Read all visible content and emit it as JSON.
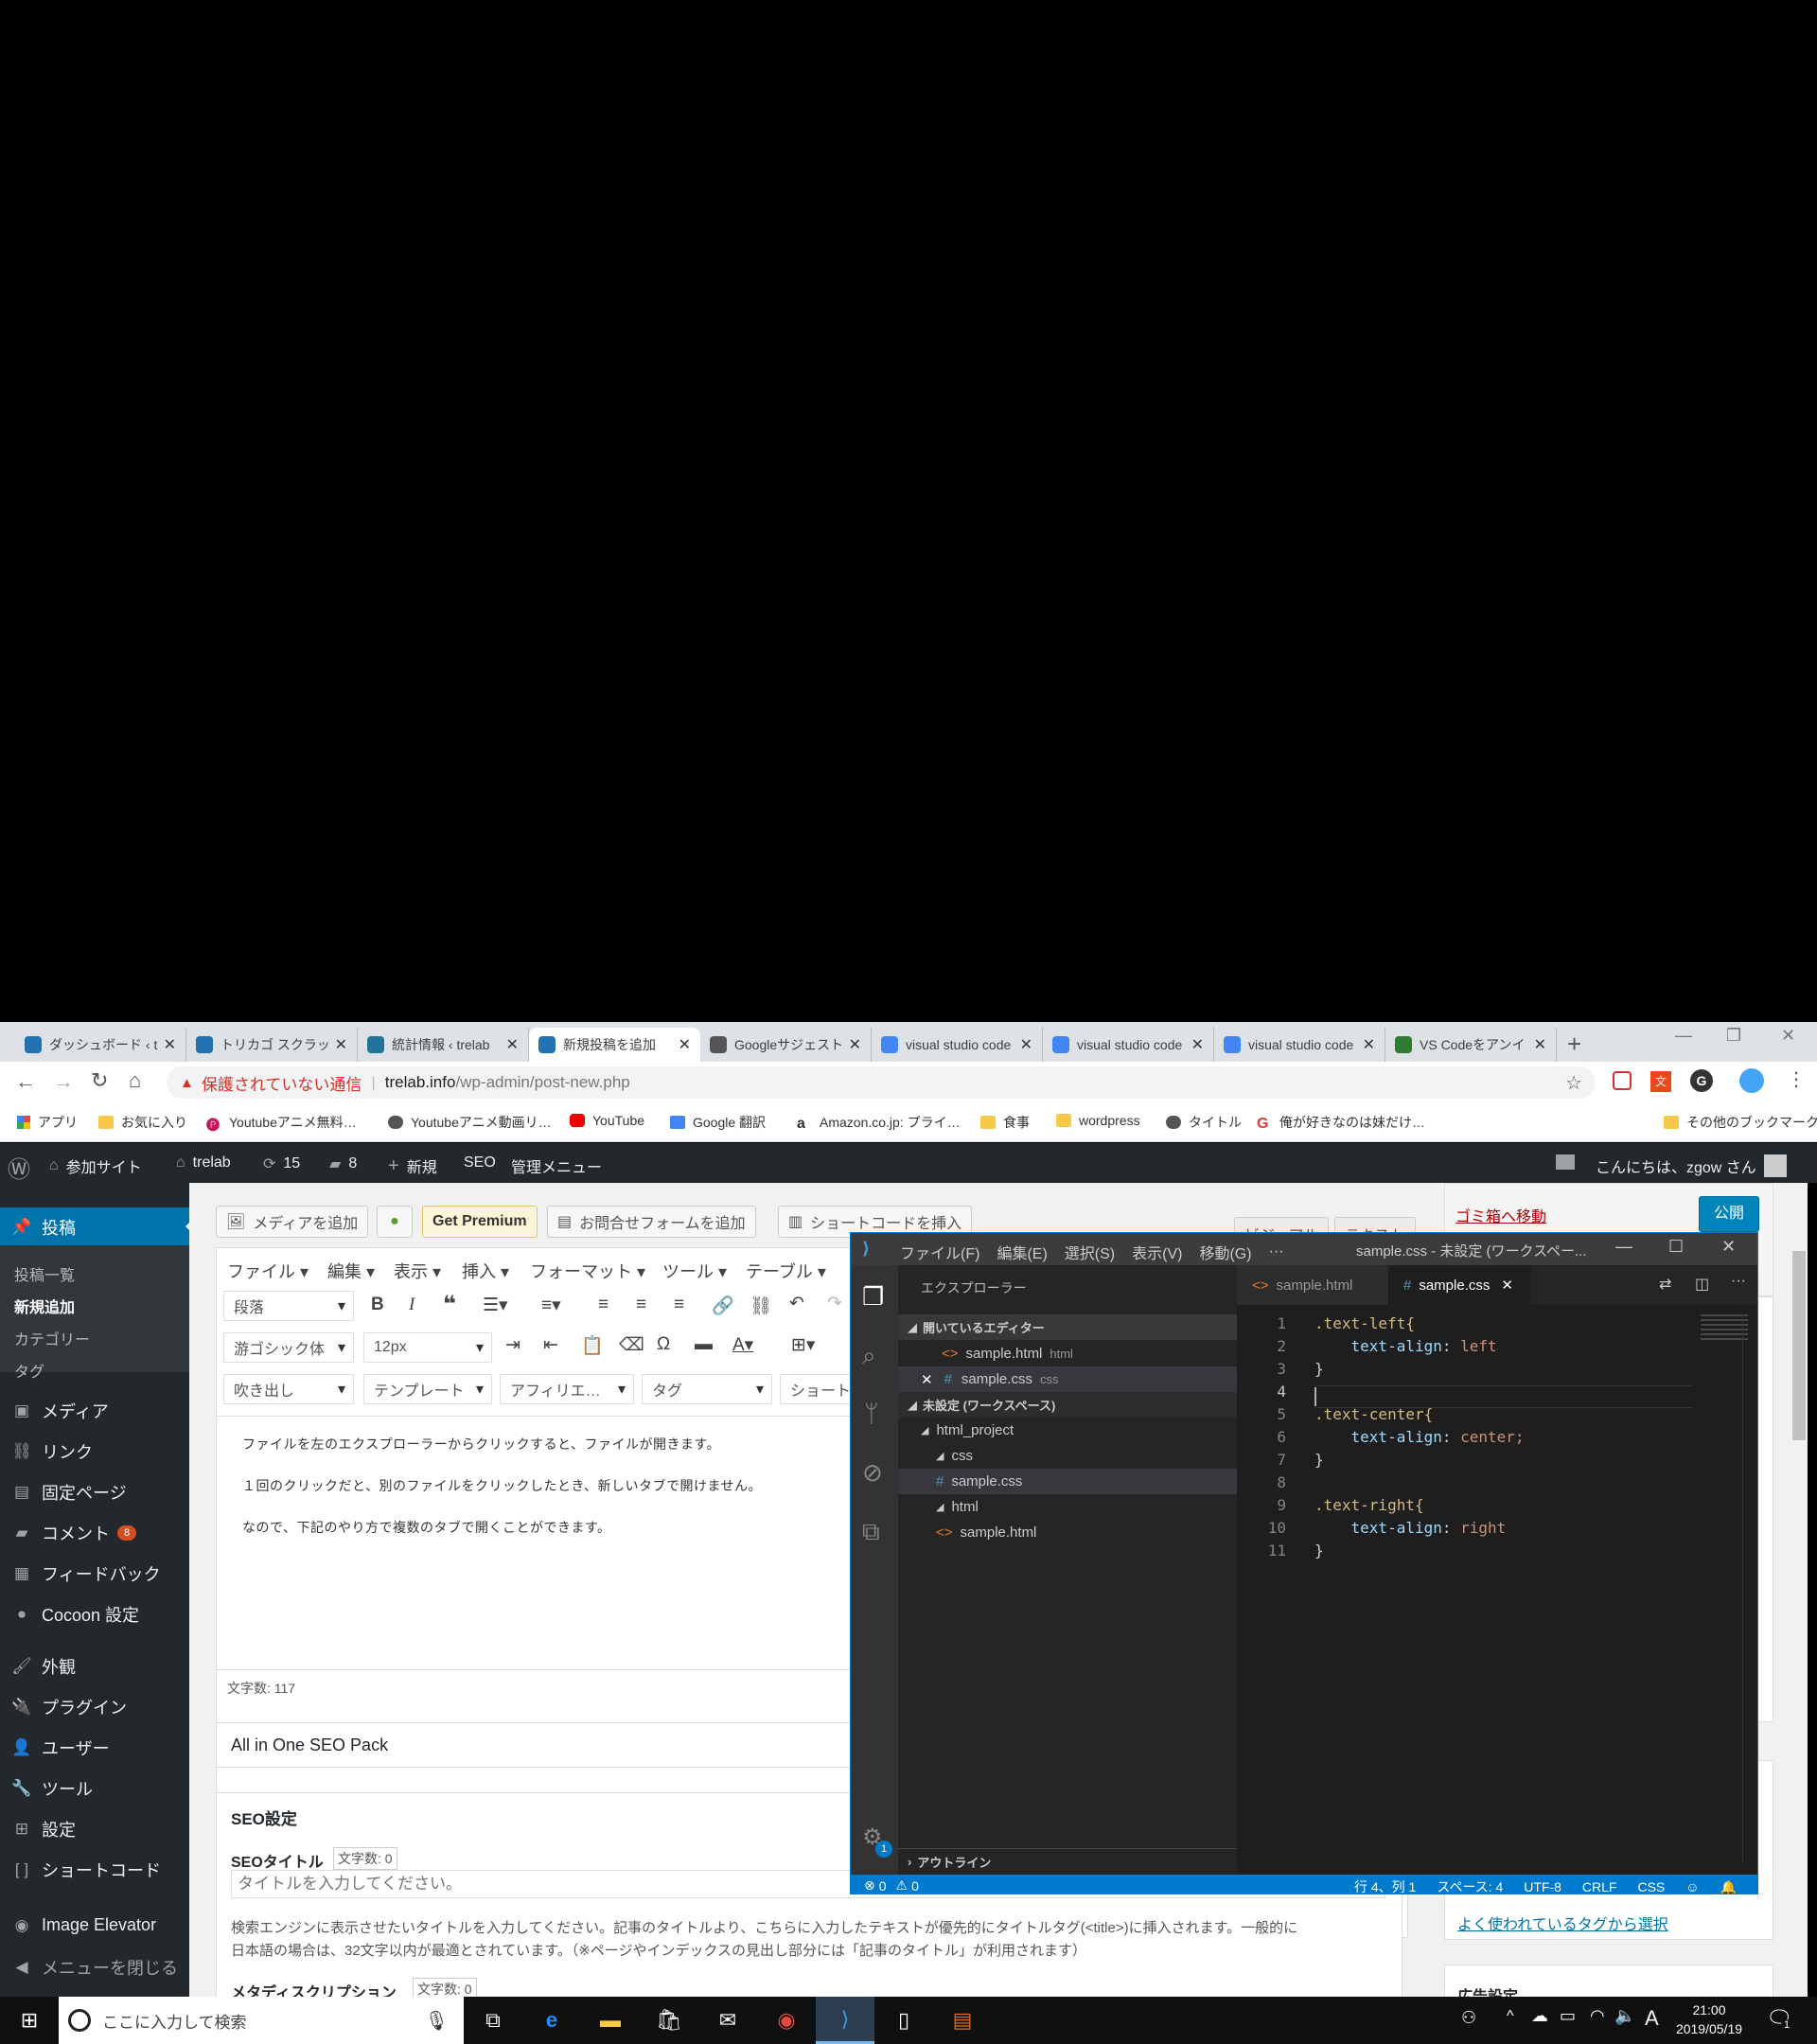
{
  "browser": {
    "tabs": [
      {
        "title": "ダッシュボード ‹ trelab",
        "fav": "#2271b1",
        "active": false
      },
      {
        "title": "トリカゴ スクラップ",
        "fav": "#2271b1",
        "active": false
      },
      {
        "title": "統計情報 ‹ trelab",
        "fav": "#21759b",
        "active": false
      },
      {
        "title": "新規投稿を追加",
        "fav": "#2271b1",
        "active": true
      },
      {
        "title": "Googleサジェスト",
        "fav": "#555",
        "active": false
      },
      {
        "title": "visual studio code",
        "fav": "#4285f4",
        "active": false
      },
      {
        "title": "visual studio code",
        "fav": "#4285f4",
        "active": false
      },
      {
        "title": "visual studio code",
        "fav": "#4285f4",
        "active": false
      },
      {
        "title": "VS Codeをアンイ",
        "fav": "#2e7d32",
        "active": false
      }
    ],
    "new_tab": "+",
    "security_warning": "保護されていない通信",
    "url_host": "trelab.info",
    "url_path": "/wp-admin/post-new.php",
    "bookmarks": [
      {
        "label": "アプリ"
      },
      {
        "label": "お気に入り"
      },
      {
        "label": "Youtubeアニメ無料…"
      },
      {
        "label": "Youtubeアニメ動画リ…"
      },
      {
        "label": "YouTube"
      },
      {
        "label": "Google 翻訳"
      },
      {
        "label": "Amazon.co.jp: プライ…"
      },
      {
        "label": "食事"
      },
      {
        "label": "wordpress"
      },
      {
        "label": "タイトル"
      },
      {
        "label": "俺が好きなのは妹だけ…"
      },
      {
        "label": "その他のブックマーク"
      }
    ]
  },
  "wp_adminbar": {
    "site_menu": "参加サイト",
    "site": "trelab",
    "updates": "15",
    "comments": "8",
    "new": "新規",
    "seo": "SEO",
    "admin_menu": "管理メニュー",
    "greeting": "こんにちは、zgow さん"
  },
  "wp_sidebar": {
    "posts": "投稿",
    "sub": [
      "投稿一覧",
      "新規追加",
      "カテゴリー",
      "タグ"
    ],
    "items": [
      "メディア",
      "リンク",
      "固定ページ",
      "コメント",
      "フィードバック",
      "Cocoon 設定",
      "外観",
      "プラグイン",
      "ユーザー",
      "ツール",
      "設定",
      "ショートコード",
      "Image Elevator",
      "メニューを閉じる"
    ],
    "comment_badge": "8"
  },
  "wp_editor": {
    "add_media": "メディアを追加",
    "get_premium": "Get Premium",
    "add_contact": "お問合せフォームを追加",
    "insert_shortcode": "ショートコードを挿入",
    "tab_visual": "ビジュアル",
    "tab_text": "テキスト",
    "menus": [
      "ファイル",
      "編集",
      "表示",
      "挿入",
      "フォーマット",
      "ツール",
      "テーブル"
    ],
    "paragraph": "段落",
    "font_family": "游ゴシック体",
    "font_size": "12px",
    "balloon": "吹き出し",
    "template": "テンプレート",
    "affiliate": "アフィリエ…",
    "tag": "タグ",
    "shortcode": "ショート",
    "content": [
      "ファイルを左のエクスプローラーからクリックすると、ファイルが開きます。",
      "１回のクリックだと、別のファイルをクリックしたとき、新しいタブで開けません。",
      "なので、下記のやり方で複数のタブで開くことができます。"
    ],
    "word_count": "文字数: 117",
    "seo_pack": "All in One SEO Pack",
    "seo_settings": "SEO設定",
    "seo_title_label": "SEOタイトル",
    "seo_title_count": "文字数: 0",
    "seo_title_placeholder": "タイトルを入力してください。",
    "seo_help_1": "検索エンジンに表示させたいタイトルを入力してください。記事のタイトルより、こちらに入力したテキストが優先的にタイトルタグ(<title>)に挿入されます。一般的に",
    "seo_help_2": "日本語の場合は、32文字以内が最適とされています。（※ページやインデックスの見出し部分には「記事のタイトル」が利用されます）",
    "meta_desc_label": "メタディスクリプション",
    "meta_desc_count": "文字数: 0"
  },
  "wp_right": {
    "trash": "ゴミ箱へ移動",
    "publish": "公開",
    "tags_link": "よく使われているタグから選択",
    "ad_settings": "広告設定"
  },
  "vscode": {
    "menu": [
      "ファイル(F)",
      "編集(E)",
      "選択(S)",
      "表示(V)",
      "移動(G)",
      "···"
    ],
    "title": "sample.css - 未設定 (ワークスペー...",
    "explorer_title": "エクスプローラー",
    "open_editors": "開いているエディター",
    "open_files": [
      {
        "name": "sample.html",
        "hint": "html"
      },
      {
        "name": "sample.css",
        "hint": "css"
      }
    ],
    "workspace": "未設定 (ワークスペース)",
    "tree": [
      "html_project",
      "css",
      "sample.css",
      "html",
      "sample.html"
    ],
    "outline": "アウトライン",
    "tabs": [
      {
        "name": "sample.html"
      },
      {
        "name": "sample.css"
      }
    ],
    "code_lines": [
      {
        "n": "1",
        "sel": ".text-left{",
        "prop": "",
        "val": ""
      },
      {
        "n": "2",
        "sel": "",
        "prop": "text-align",
        "val": "left"
      },
      {
        "n": "3",
        "sel": "}",
        "prop": "",
        "val": ""
      },
      {
        "n": "4",
        "sel": "",
        "prop": "",
        "val": ""
      },
      {
        "n": "5",
        "sel": ".text-center{",
        "prop": "",
        "val": ""
      },
      {
        "n": "6",
        "sel": "",
        "prop": "text-align",
        "val": "center;"
      },
      {
        "n": "7",
        "sel": "}",
        "prop": "",
        "val": ""
      },
      {
        "n": "8",
        "sel": "",
        "prop": "",
        "val": ""
      },
      {
        "n": "9",
        "sel": ".text-right{",
        "prop": "",
        "val": ""
      },
      {
        "n": "10",
        "sel": "",
        "prop": "text-align",
        "val": "right"
      },
      {
        "n": "11",
        "sel": "}",
        "prop": "",
        "val": ""
      }
    ],
    "status": {
      "errors": "0",
      "warnings": "0",
      "position": "行 4、列 1",
      "spaces": "スペース: 4",
      "encoding": "UTF-8",
      "eol": "CRLF",
      "lang": "CSS"
    },
    "badge": "1"
  },
  "taskbar": {
    "search_placeholder": "ここに入力して検索",
    "time": "21:00",
    "date": "2019/05/19",
    "ime": "A",
    "notify": "1"
  }
}
